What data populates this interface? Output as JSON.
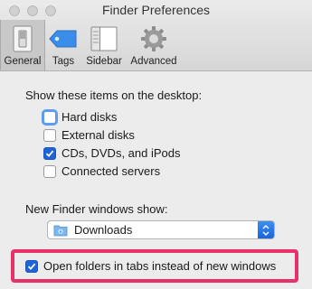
{
  "window": {
    "title": "Finder Preferences"
  },
  "toolbar": {
    "tabs": [
      {
        "label": "General",
        "icon": "switch-icon"
      },
      {
        "label": "Tags",
        "icon": "tag-icon"
      },
      {
        "label": "Sidebar",
        "icon": "sidebar-icon"
      },
      {
        "label": "Advanced",
        "icon": "gear-icon"
      }
    ],
    "selected": "General"
  },
  "desktop": {
    "heading": "Show these items on the desktop:",
    "items": [
      {
        "label": "Hard disks",
        "checked": false
      },
      {
        "label": "External disks",
        "checked": false
      },
      {
        "label": "CDs, DVDs, and iPods",
        "checked": true
      },
      {
        "label": "Connected servers",
        "checked": false
      }
    ]
  },
  "new_window": {
    "heading": "New Finder windows show:",
    "selected_value": "Downloads"
  },
  "open_in_tabs": {
    "label": "Open folders in tabs instead of new windows",
    "checked": true
  },
  "colors": {
    "accent": "#1f64d6",
    "highlight": "#e8316b"
  }
}
